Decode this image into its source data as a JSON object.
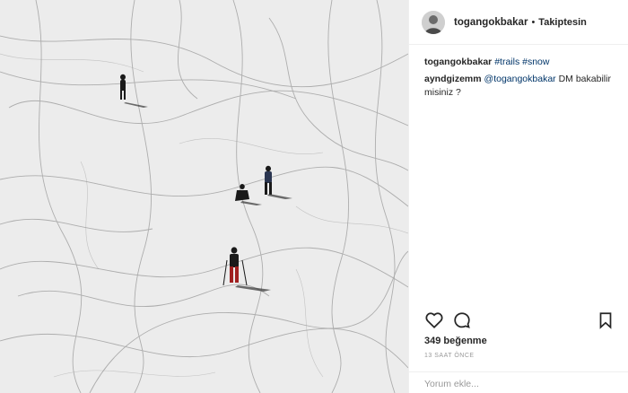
{
  "post": {
    "username": "togangokbakar",
    "separator": "•",
    "follow_label": "Takiptesin",
    "caption_user": "togangokbakar",
    "hashtags": [
      "#trails",
      "#snow"
    ],
    "comments": [
      {
        "user": "ayndgizemm",
        "mention": "@togangokbakar",
        "text": " DM bakabilir misiniz ?"
      }
    ],
    "likes": "349 beğenme",
    "timestamp": "13 SAAT ÖNCE",
    "comment_placeholder": "Yorum ekle..."
  },
  "icons": {
    "like": "heart-icon",
    "comment": "comment-bubble-icon",
    "save": "bookmark-icon"
  },
  "colors": {
    "link": "#003569",
    "text": "#262626",
    "muted": "#999999",
    "border": "#efefef"
  }
}
